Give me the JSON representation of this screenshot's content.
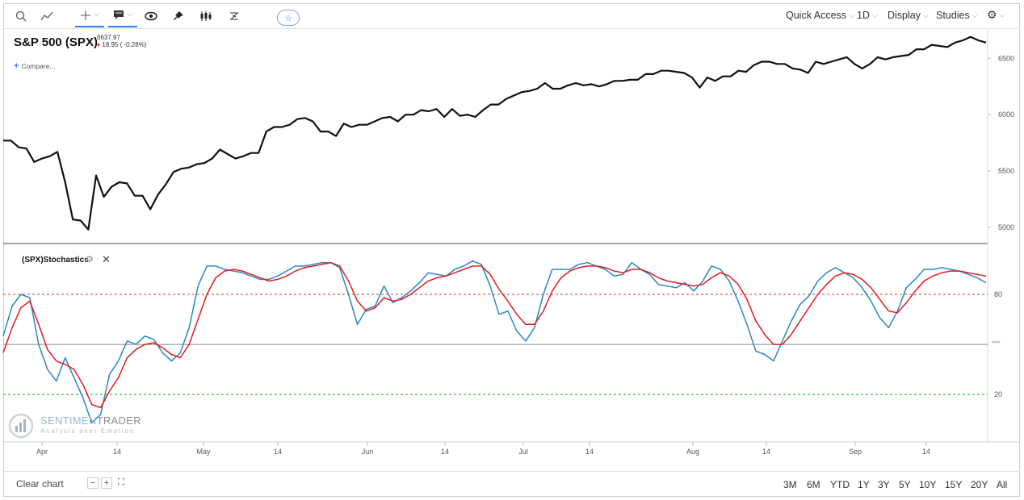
{
  "toolbar": {
    "menus": [
      "Quick Access",
      "1D",
      "Display",
      "Studies"
    ]
  },
  "header": {
    "title": "S&P 500 (SPX)",
    "price": "6637.97",
    "change": "18.95 ( -0.28%)",
    "compare": "Compare..."
  },
  "stoch": {
    "label": "(SPX)Stochastics"
  },
  "logo": {
    "name1": "SENTIMEN",
    "name2": "TRADER",
    "tagline": "Analysis over Emotion"
  },
  "bottom": {
    "clear": "Clear chart",
    "zoom": [
      "−",
      "+",
      "⛶"
    ],
    "ranges": [
      "3M",
      "6M",
      "YTD",
      "1Y",
      "3Y",
      "5Y",
      "10Y",
      "15Y",
      "20Y",
      "All"
    ]
  },
  "colors": {
    "price": "#111111",
    "k": "#2a87c5",
    "d": "#e21b1b",
    "ob": "#e05a5a",
    "os": "#3cc43c"
  },
  "chart_data": [
    {
      "type": "line",
      "title": "S&P 500 (SPX)",
      "ylim": [
        4870,
        6760
      ],
      "y_ticks": [
        5000,
        5500,
        6000,
        6500
      ],
      "x_ticks": [
        "Apr",
        "14",
        "May",
        "14",
        "Jun",
        "14",
        "Jul",
        "14",
        "Aug",
        "14",
        "Sep",
        "14"
      ],
      "series": [
        {
          "values": [
            5770,
            5770,
            5710,
            5700,
            5580,
            5610,
            5630,
            5670,
            5400,
            5070,
            5060,
            4980,
            5460,
            5270,
            5360,
            5400,
            5390,
            5280,
            5280,
            5160,
            5290,
            5380,
            5490,
            5520,
            5530,
            5560,
            5570,
            5610,
            5690,
            5650,
            5610,
            5630,
            5660,
            5660,
            5850,
            5890,
            5890,
            5910,
            5960,
            5970,
            5940,
            5850,
            5850,
            5810,
            5920,
            5890,
            5910,
            5910,
            5940,
            5970,
            5980,
            5940,
            6000,
            6000,
            6040,
            6030,
            6050,
            5980,
            6050,
            5990,
            6000,
            5980,
            6040,
            6090,
            6090,
            6140,
            6170,
            6200,
            6210,
            6230,
            6280,
            6230,
            6230,
            6260,
            6280,
            6260,
            6270,
            6250,
            6270,
            6300,
            6300,
            6310,
            6310,
            6360,
            6360,
            6390,
            6390,
            6380,
            6370,
            6330,
            6240,
            6330,
            6300,
            6340,
            6340,
            6390,
            6380,
            6440,
            6470,
            6470,
            6450,
            6450,
            6410,
            6400,
            6370,
            6470,
            6450,
            6470,
            6490,
            6510,
            6450,
            6410,
            6450,
            6510,
            6490,
            6510,
            6520,
            6530,
            6580,
            6580,
            6620,
            6610,
            6600,
            6640,
            6660,
            6690,
            6660,
            6640
          ]
        }
      ]
    },
    {
      "type": "line",
      "title": "(SPX)Stochastics",
      "ylim": [
        -8,
        110
      ],
      "y_ticks": [
        20,
        80
      ],
      "series": [
        {
          "values": [
            55,
            73,
            80,
            78,
            50,
            35,
            28,
            42,
            30,
            18,
            3,
            8,
            32,
            40,
            52,
            50,
            55,
            53,
            45,
            40,
            45,
            60,
            85,
            97,
            97,
            95,
            94,
            93,
            91,
            89,
            89,
            91,
            94,
            97,
            97,
            98,
            99,
            99,
            96,
            80,
            62,
            71,
            73,
            85,
            75,
            78,
            82,
            87,
            93,
            92,
            91,
            95,
            97,
            100,
            98,
            85,
            68,
            70,
            58,
            52,
            60,
            80,
            95,
            95,
            95,
            98,
            99,
            97,
            95,
            91,
            92,
            99,
            95,
            92,
            86,
            85,
            84,
            87,
            82,
            88,
            97,
            95,
            88,
            76,
            62,
            46,
            44,
            40,
            52,
            64,
            74,
            79,
            88,
            93,
            96,
            93,
            90,
            84,
            76,
            66,
            60,
            70,
            84,
            89,
            95,
            95,
            96,
            95,
            94,
            92,
            90,
            87
          ]
        },
        {
          "values": [
            45,
            60,
            72,
            76,
            62,
            47,
            40,
            38,
            35,
            26,
            14,
            12,
            22,
            30,
            42,
            47,
            50,
            51,
            48,
            44,
            42,
            50,
            65,
            80,
            90,
            94,
            95,
            94,
            92,
            90,
            88,
            89,
            91,
            94,
            96,
            97,
            98,
            99,
            97,
            88,
            76,
            70,
            72,
            78,
            76,
            77,
            80,
            84,
            88,
            90,
            91,
            93,
            95,
            97,
            97,
            92,
            83,
            76,
            68,
            62,
            62,
            70,
            82,
            90,
            94,
            96,
            97,
            97,
            96,
            94,
            93,
            95,
            95,
            93,
            90,
            88,
            87,
            86,
            85,
            86,
            90,
            93,
            91,
            86,
            77,
            64,
            56,
            50,
            50,
            56,
            64,
            72,
            80,
            86,
            91,
            93,
            92,
            89,
            84,
            77,
            70,
            69,
            75,
            82,
            88,
            91,
            93,
            94,
            94,
            93,
            92,
            91
          ]
        }
      ],
      "reference_lines": [
        80,
        50,
        20
      ]
    }
  ]
}
